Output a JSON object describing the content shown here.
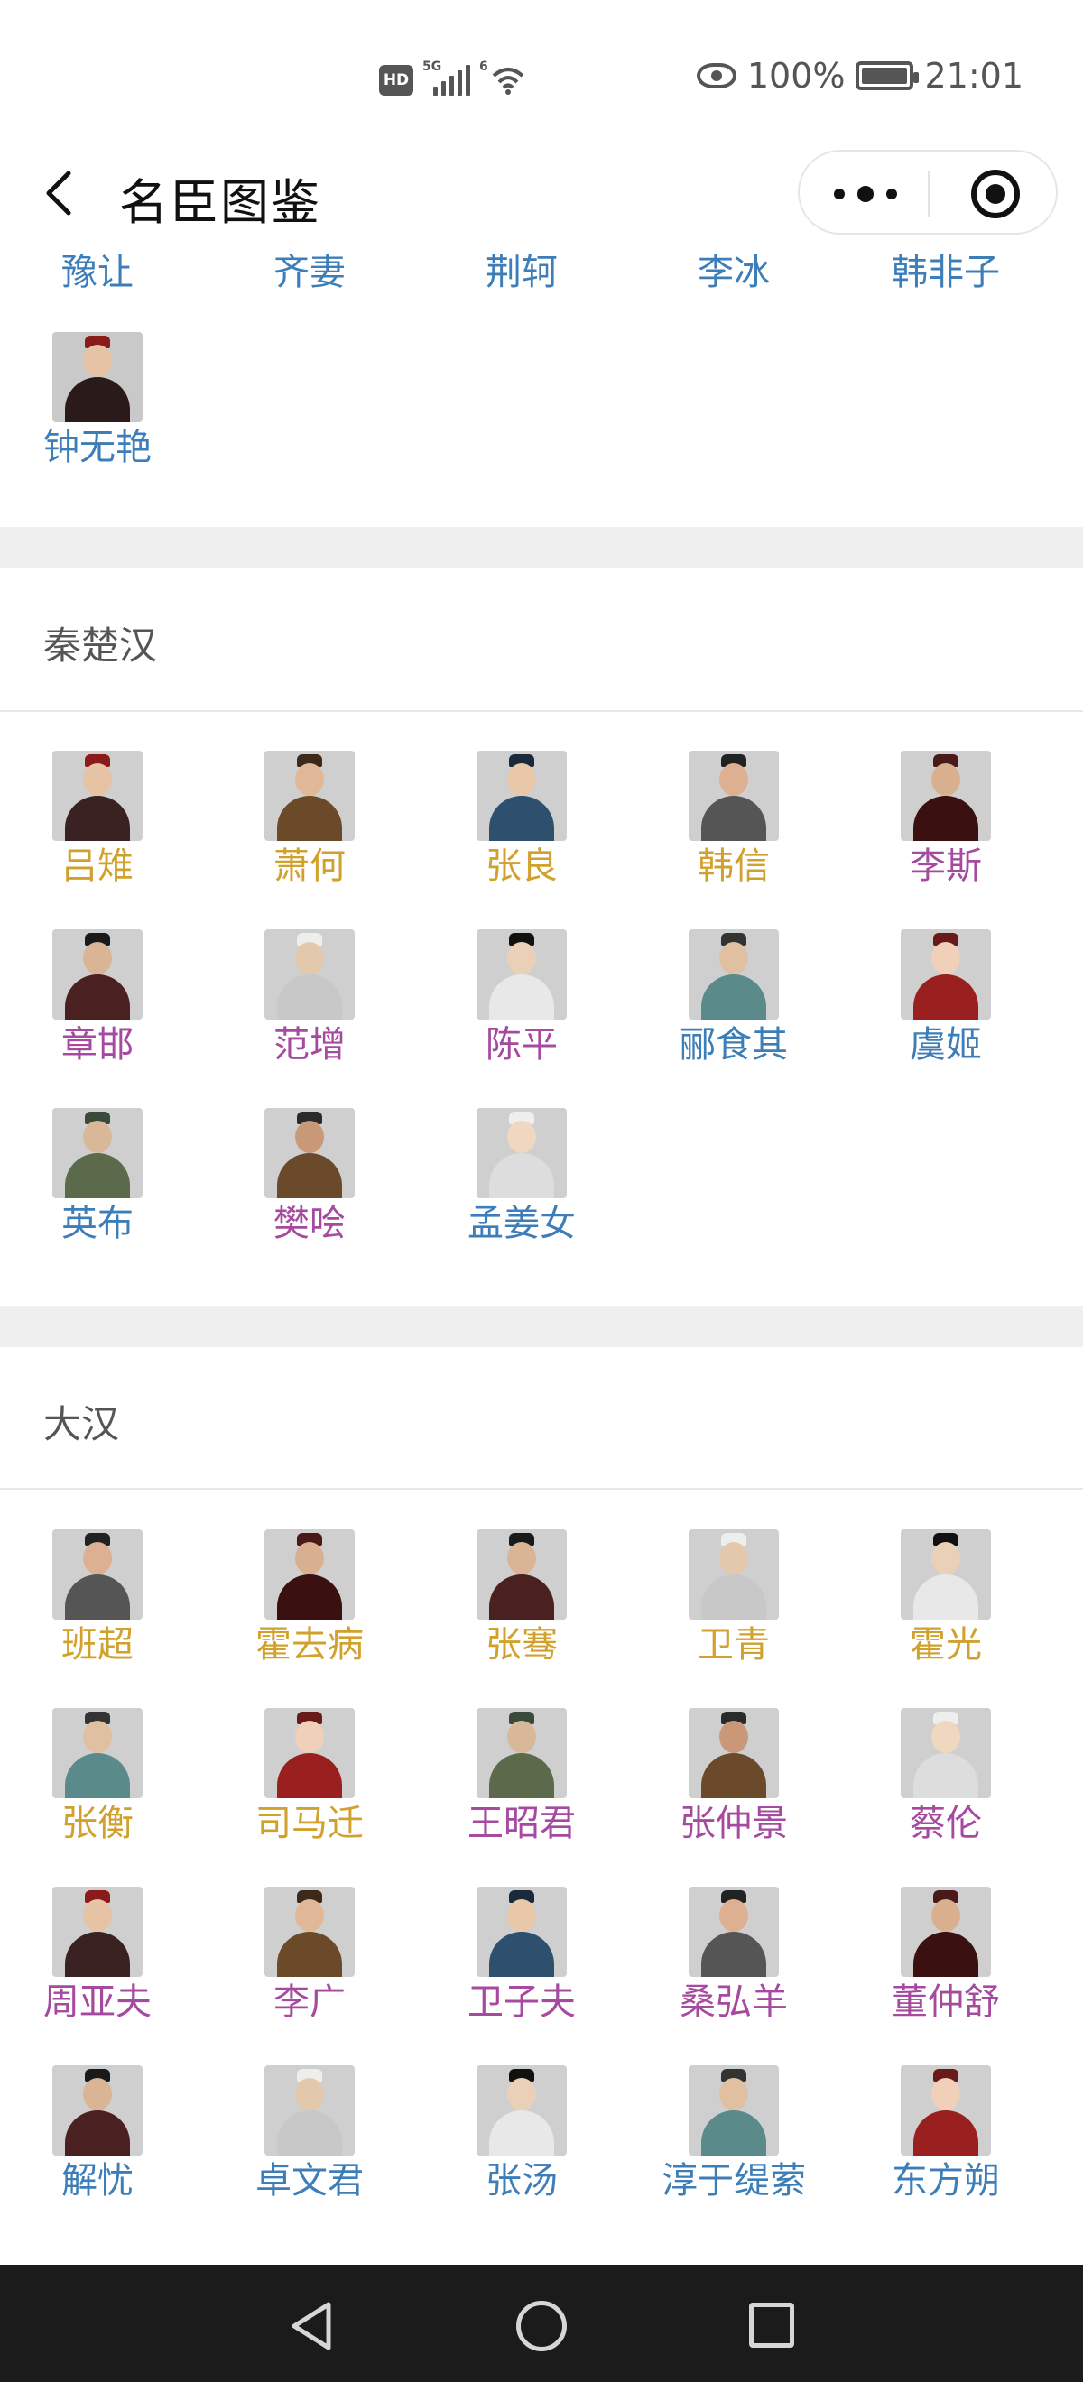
{
  "status_bar": {
    "hd_label": "HD",
    "network_label": "5G",
    "wifi_label": "6",
    "battery_text": "100%",
    "time": "21:01"
  },
  "header": {
    "title": "名臣图鉴"
  },
  "colors": {
    "blue": "#3d7eb8",
    "gold": "#d1a12e",
    "purple": "#a64aa0",
    "band": "#efefef"
  },
  "prev_section": {
    "names_row": [
      {
        "name": "豫让",
        "color": "blue"
      },
      {
        "name": "齐妻",
        "color": "blue"
      },
      {
        "name": "荆轲",
        "color": "blue"
      },
      {
        "name": "李冰",
        "color": "blue"
      },
      {
        "name": "韩非子",
        "color": "blue"
      }
    ],
    "items": [
      {
        "name": "钟无艳",
        "color": "blue",
        "icon": "portrait-icon"
      }
    ]
  },
  "sections": [
    {
      "title": "秦楚汉",
      "items": [
        {
          "name": "吕雉",
          "color": "gold"
        },
        {
          "name": "萧何",
          "color": "gold"
        },
        {
          "name": "张良",
          "color": "gold"
        },
        {
          "name": "韩信",
          "color": "gold"
        },
        {
          "name": "李斯",
          "color": "purple"
        },
        {
          "name": "章邯",
          "color": "purple"
        },
        {
          "name": "范增",
          "color": "purple"
        },
        {
          "name": "陈平",
          "color": "purple"
        },
        {
          "name": "郦食其",
          "color": "blue"
        },
        {
          "name": "虞姬",
          "color": "blue"
        },
        {
          "name": "英布",
          "color": "blue"
        },
        {
          "name": "樊哙",
          "color": "purple"
        },
        {
          "name": "孟姜女",
          "color": "blue"
        }
      ]
    },
    {
      "title": "大汉",
      "items": [
        {
          "name": "班超",
          "color": "gold"
        },
        {
          "name": "霍去病",
          "color": "gold"
        },
        {
          "name": "张骞",
          "color": "gold"
        },
        {
          "name": "卫青",
          "color": "gold"
        },
        {
          "name": "霍光",
          "color": "gold"
        },
        {
          "name": "张衡",
          "color": "gold"
        },
        {
          "name": "司马迁",
          "color": "gold"
        },
        {
          "name": "王昭君",
          "color": "purple"
        },
        {
          "name": "张仲景",
          "color": "purple"
        },
        {
          "name": "蔡伦",
          "color": "purple"
        },
        {
          "name": "周亚夫",
          "color": "purple"
        },
        {
          "name": "李广",
          "color": "purple"
        },
        {
          "name": "卫子夫",
          "color": "purple"
        },
        {
          "name": "桑弘羊",
          "color": "purple"
        },
        {
          "name": "董仲舒",
          "color": "purple"
        },
        {
          "name": "解忧",
          "color": "blue"
        },
        {
          "name": "卓文君",
          "color": "blue"
        },
        {
          "name": "张汤",
          "color": "blue"
        },
        {
          "name": "淳于缇萦",
          "color": "blue"
        },
        {
          "name": "东方朔",
          "color": "blue"
        }
      ]
    }
  ],
  "nav": {
    "back_icon": "triangle-back-icon",
    "home_icon": "circle-home-icon",
    "recent_icon": "square-recent-icon"
  }
}
